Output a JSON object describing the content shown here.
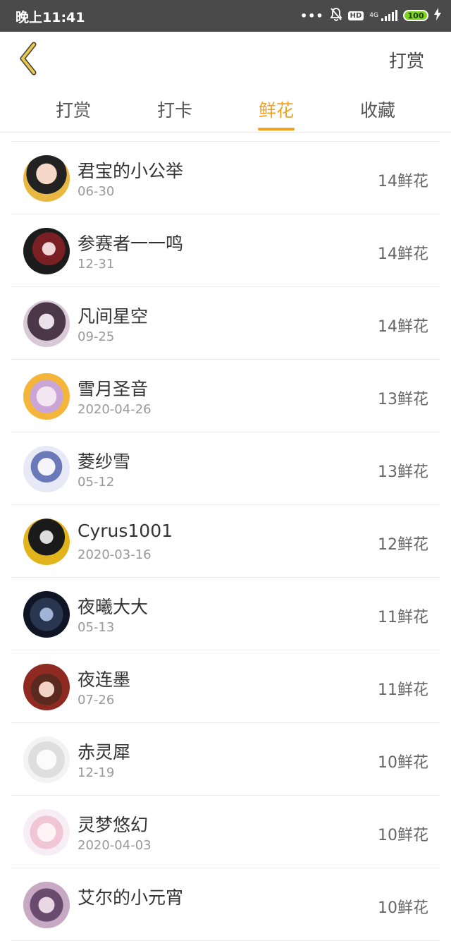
{
  "statusbar": {
    "time": "晚上11:41",
    "dots": "•••",
    "hd": "HD",
    "net": "4G",
    "battery": "100"
  },
  "header": {
    "action_label": "打赏"
  },
  "tabs": [
    {
      "label": "打赏",
      "active": false
    },
    {
      "label": "打卡",
      "active": false
    },
    {
      "label": "鲜花",
      "active": true
    },
    {
      "label": "收藏",
      "active": false
    }
  ],
  "colors": {
    "accent": "#f2a21e",
    "back_arrow": "#e8c84a",
    "statusbar_bg": "#4a4a4a"
  },
  "list": [
    {
      "name": "君宝的小公举",
      "date": "06-30",
      "count": "14鲜花"
    },
    {
      "name": "参赛者一一鸣",
      "date": "12-31",
      "count": "14鲜花"
    },
    {
      "name": "凡间星空",
      "date": "09-25",
      "count": "14鲜花"
    },
    {
      "name": "雪月圣音",
      "date": "2020-04-26",
      "count": "13鲜花"
    },
    {
      "name": "菱纱雪",
      "date": "05-12",
      "count": "13鲜花"
    },
    {
      "name": "Cyrus1001",
      "date": "2020-03-16",
      "count": "12鲜花"
    },
    {
      "name": "夜曦大大",
      "date": "05-13",
      "count": "11鲜花"
    },
    {
      "name": "夜连墨",
      "date": "07-26",
      "count": "11鲜花"
    },
    {
      "name": "赤灵犀",
      "date": "12-19",
      "count": "10鲜花"
    },
    {
      "name": "灵梦悠幻",
      "date": "2020-04-03",
      "count": "10鲜花"
    },
    {
      "name": "艾尔的小元宵",
      "date": "",
      "count": "10鲜花"
    }
  ]
}
